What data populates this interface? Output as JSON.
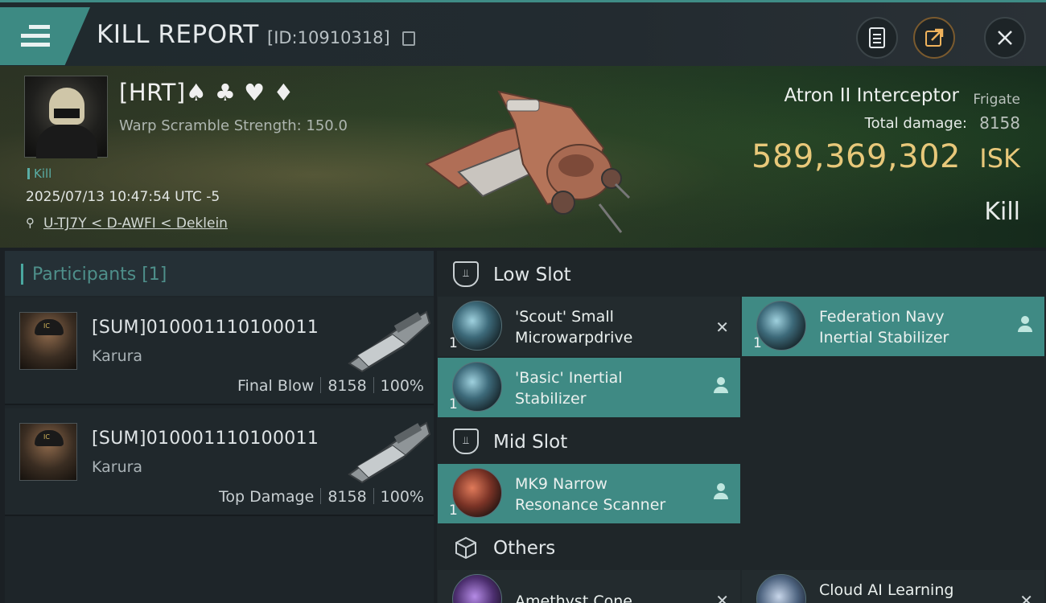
{
  "header": {
    "title": "KILL REPORT",
    "report_id": "[ID:10910318]",
    "icons": {
      "menu": "hamburger-menu-icon",
      "copy": "copy-icon",
      "notes": "notes-icon",
      "share": "share-icon",
      "close": "close-icon"
    },
    "accent_color": "#3d8a83"
  },
  "victim": {
    "pilot_name": "[HRT]♠ ♣ ♥ ♦",
    "warp_scramble": "Warp Scramble Strength: 150.0",
    "kill_tag": "Kill",
    "datetime": "2025/07/13 10:47:54 UTC -5",
    "location": "U-TJ7Y < D-AWFI < Deklein",
    "ship_name": "Atron II Interceptor",
    "ship_class": "Frigate",
    "total_damage_label": "Total damage:",
    "total_damage": "8158",
    "isk_value": "589,369,302",
    "isk_unit": "ISK",
    "kill_type": "Kill",
    "isk_color": "#e8c87a"
  },
  "participants": {
    "header": "Participants [1]",
    "rows": [
      {
        "name": "[SUM]010001110100011",
        "ship": "Karura",
        "role": "Final Blow",
        "damage": "8158",
        "percent": "100%"
      },
      {
        "name": "[SUM]010001110100011",
        "ship": "Karura",
        "role": "Top Damage",
        "damage": "8158",
        "percent": "100%"
      }
    ]
  },
  "fitting": {
    "low_slot": {
      "label": "Low Slot",
      "modules": [
        {
          "name_line1": "'Scout' Small",
          "name_line2": "Microwarpdrive",
          "qty": "1",
          "state": "x-icon"
        },
        {
          "name_line1": "Federation Navy",
          "name_line2": "Inertial Stabilizer",
          "qty": "1",
          "state": "user-icon"
        },
        {
          "name_line1": "'Basic' Inertial",
          "name_line2": "Stabilizer",
          "qty": "1",
          "state": "user-icon"
        }
      ]
    },
    "mid_slot": {
      "label": "Mid Slot",
      "modules": [
        {
          "name_line1": "MK9 Narrow",
          "name_line2": "Resonance Scanner",
          "qty": "1",
          "state": "user-icon"
        }
      ]
    },
    "others": {
      "label": "Others",
      "modules": [
        {
          "name_line1": "Amethyst Cone",
          "state": "x-icon"
        },
        {
          "name_line1": "Cloud AI Learning",
          "state": "x-icon"
        }
      ]
    }
  }
}
